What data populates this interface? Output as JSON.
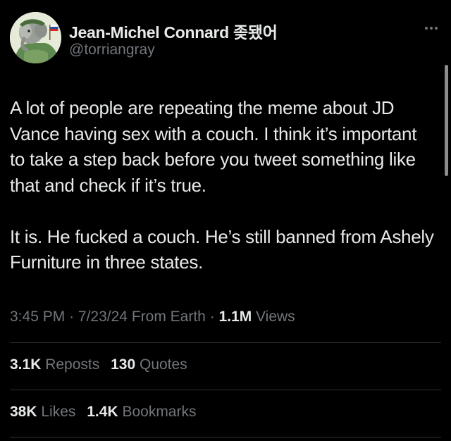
{
  "author": {
    "display_name": "Jean-Michel Connard 좆됐어",
    "handle": "@torriangray"
  },
  "tweet": {
    "paragraphs": [
      "A lot of people are repeating the meme about JD Vance having sex with a couch. I think it’s important to take a step back before you tweet something like that and check if it’s true.",
      "It is. He fucked a couch. He’s still banned from Ashely Furniture in three states."
    ],
    "time": "3:45 PM",
    "date": "7/23/24",
    "source": "From Earth",
    "views_count": "1.1M",
    "views_label": "Views"
  },
  "stats": {
    "reposts_count": "3.1K",
    "reposts_label": "Reposts",
    "quotes_count": "130",
    "quotes_label": "Quotes",
    "likes_count": "38K",
    "likes_label": "Likes",
    "bookmarks_count": "1.4K",
    "bookmarks_label": "Bookmarks"
  },
  "icons": {
    "more": "more-horizontal-icon"
  },
  "colors": {
    "background": "#000000",
    "primary_text": "#e7e9ea",
    "secondary_text": "#71767b",
    "divider": "#2f3336"
  }
}
